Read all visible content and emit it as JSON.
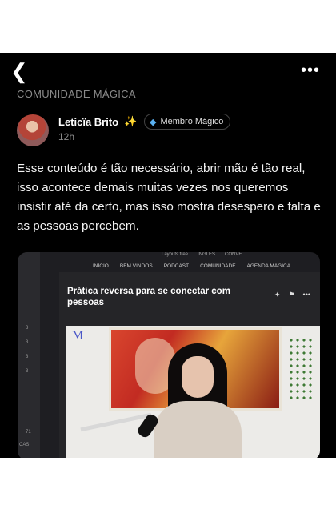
{
  "header": {
    "back_icon": "chevron-left-icon",
    "more_icon": "more-icon"
  },
  "community": "COMUNIDADE MÁGICA",
  "author": {
    "name": "Leticïa Brito",
    "sparkle": "✨",
    "time": "12h",
    "badge_label": "Membro Mágico",
    "badge_icon": "diamond-icon"
  },
  "post": {
    "text": "Esse conteúdo é tão necessário, abrir mão é tão real, isso acontece demais muitas vezes nos queremos insistir até da certo, mas isso mostra desespero e falta e as pessoas percebem."
  },
  "media": {
    "top_links": [
      "Layouts free",
      "INGLÊS",
      "CONVE"
    ],
    "nav": [
      "INÍCIO",
      "BEM VINDOS",
      "PODCAST",
      "COMUNIDADE",
      "AGENDA MÁGICA"
    ],
    "card_title": "Prática reversa para se conectar com pessoas",
    "side_numbers": [
      "3",
      "3",
      "3",
      "3",
      "71",
      "CAS"
    ]
  },
  "colors": {
    "background": "#000000",
    "secondary_text": "#8a8a8a",
    "badge_gem": "#5ab0f0"
  }
}
